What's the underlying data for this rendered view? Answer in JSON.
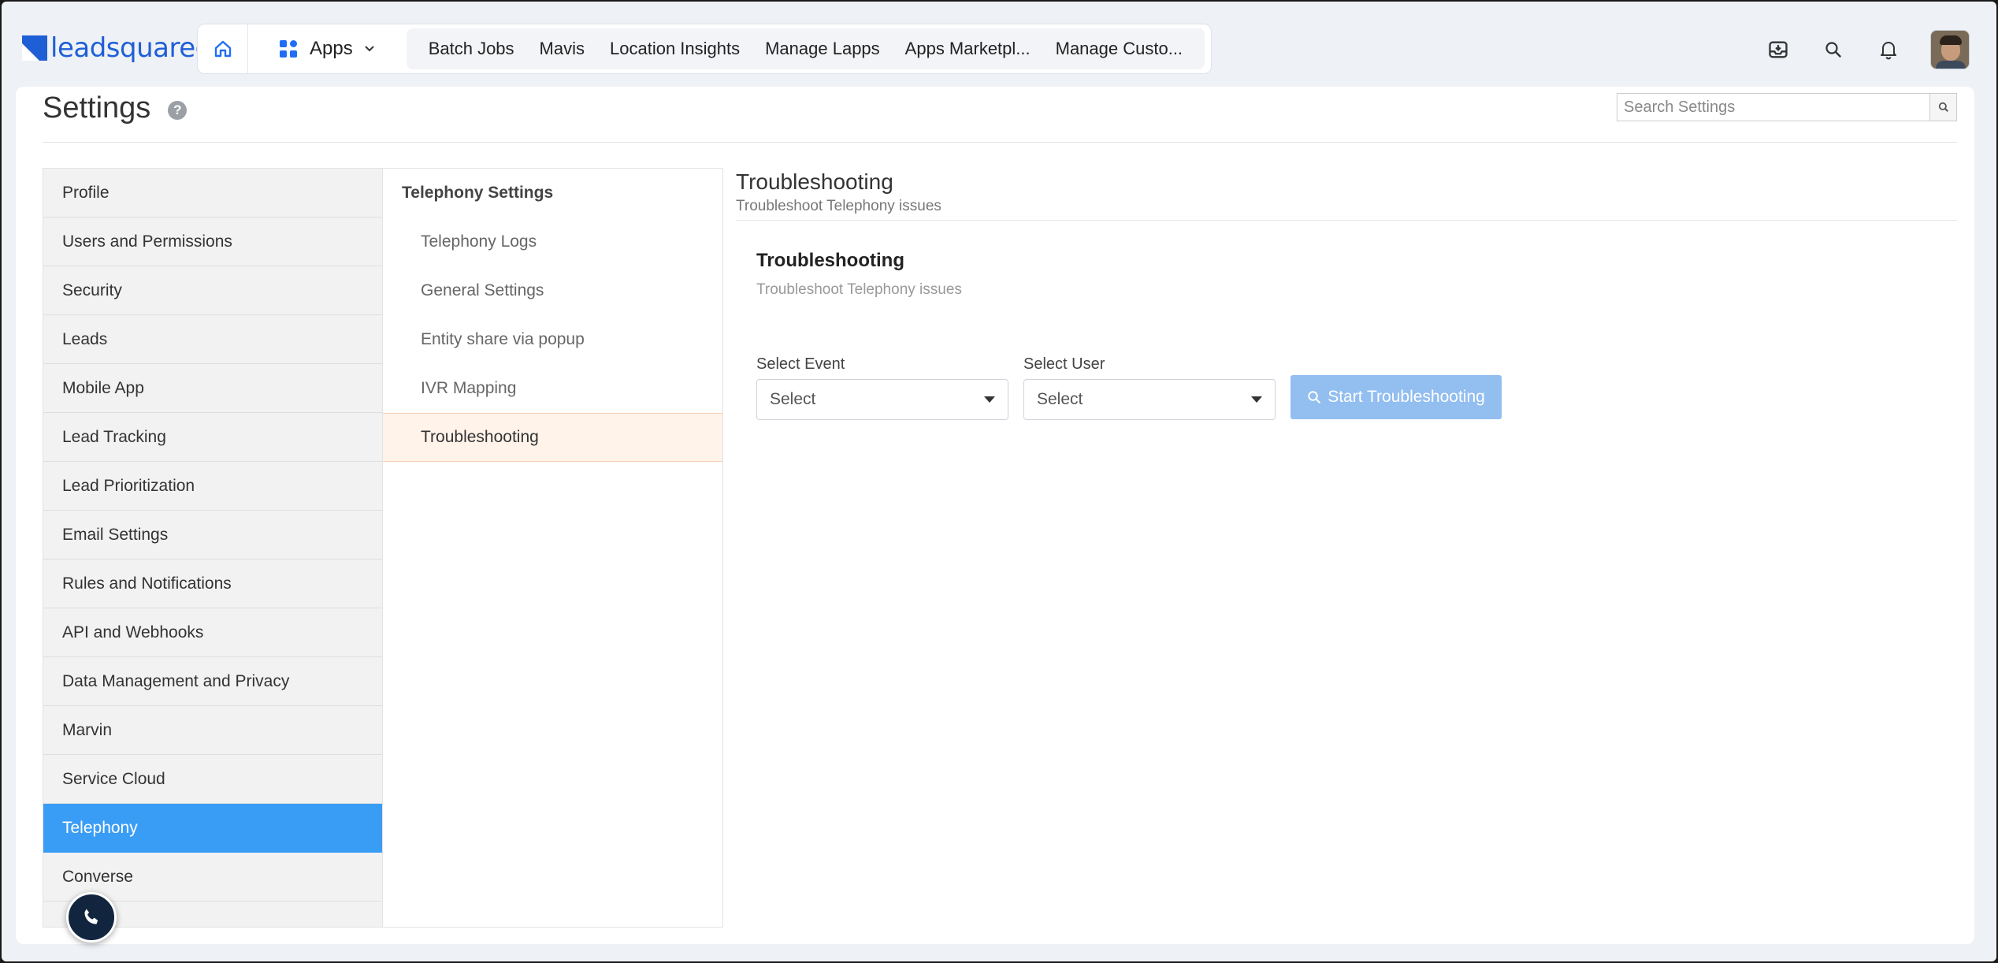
{
  "brand": {
    "name": "leadsquared",
    "accent": "#1f5fd6"
  },
  "topnav": {
    "apps_label": "Apps",
    "links": [
      "Batch Jobs",
      "Mavis",
      "Location Insights",
      "Manage Lapps",
      "Apps Marketpl...",
      "Manage Custo..."
    ],
    "icons": [
      "home-icon",
      "apps-grid-icon",
      "chevron-down-icon",
      "inbox-download-icon",
      "search-icon",
      "bell-icon",
      "avatar"
    ]
  },
  "page": {
    "title": "Settings",
    "help_glyph": "?",
    "search_placeholder": "Search Settings"
  },
  "sidebar": {
    "active_color": "#3a9df5",
    "items": [
      "Profile",
      "Users and Permissions",
      "Security",
      "Leads",
      "Mobile App",
      "Lead Tracking",
      "Lead Prioritization",
      "Email Settings",
      "Rules and Notifications",
      "API and Webhooks",
      "Data Management and Privacy",
      "Marvin",
      "Service Cloud",
      "Telephony",
      "Converse"
    ],
    "active": "Telephony"
  },
  "submenu": {
    "header": "Telephony Settings",
    "items": [
      "Telephony Logs",
      "General Settings",
      "Entity share via popup",
      "IVR Mapping",
      "Troubleshooting"
    ],
    "active": "Troubleshooting"
  },
  "content": {
    "title": "Troubleshooting",
    "subtitle": "Troubleshoot Telephony issues",
    "panel_title": "Troubleshooting",
    "panel_subtitle": "Troubleshoot Telephony issues",
    "event_label": "Select Event",
    "event_value": "Select",
    "user_label": "Select User",
    "user_value": "Select",
    "start_button": "Start Troubleshooting",
    "button_color": "#92bef0"
  }
}
